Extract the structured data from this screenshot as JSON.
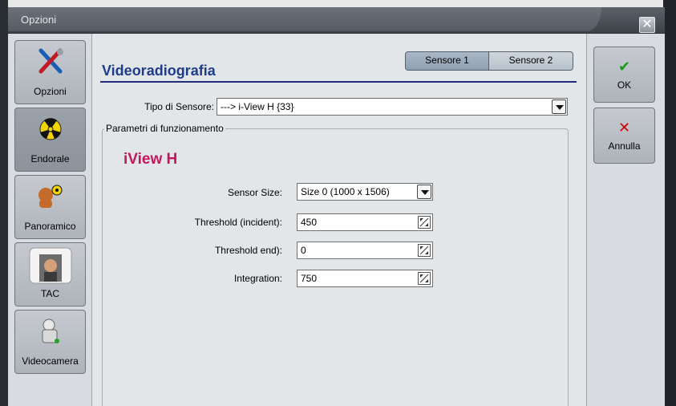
{
  "window": {
    "title": "Opzioni",
    "close_glyph": "✕"
  },
  "nav": {
    "items": [
      {
        "label": "Opzioni",
        "icon": "tools-icon"
      },
      {
        "label": "Endorale",
        "icon": "radiation-icon"
      },
      {
        "label": "Panoramico",
        "icon": "person-radiation-icon"
      },
      {
        "label": "TAC",
        "icon": "scanner-icon"
      },
      {
        "label": "Videocamera",
        "icon": "camera-icon"
      }
    ]
  },
  "main": {
    "title": "Videoradiografia",
    "sensor_tabs": [
      "Sensore 1",
      "Sensore 2"
    ],
    "sensor_type": {
      "label": "Tipo di Sensore:",
      "value": "---> i-View H {33}"
    },
    "group": {
      "legend": "Parametri di funzionamento",
      "sensor_name": "iView H",
      "fields": {
        "sensor_size": {
          "label": "Sensor Size:",
          "value": "Size 0 (1000 x 1506)"
        },
        "threshold_incident": {
          "label": "Threshold (incident):",
          "value": "450"
        },
        "threshold_end": {
          "label": "Threshold end):",
          "value": "0"
        },
        "integration": {
          "label": "Integration:",
          "value": "750"
        }
      }
    }
  },
  "actions": {
    "ok": {
      "label": "OK",
      "glyph": "✔",
      "color": "#1a9a1a"
    },
    "cancel": {
      "label": "Annulla",
      "glyph": "✕",
      "color": "#cc0000"
    }
  }
}
